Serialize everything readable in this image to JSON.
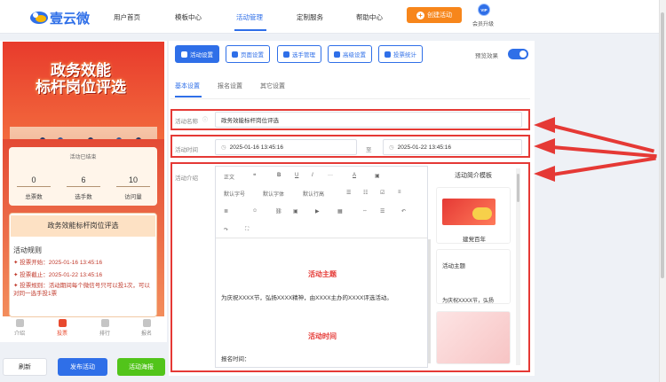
{
  "brand": {
    "name": "壹云微"
  },
  "nav": {
    "items": [
      "用户首页",
      "模板中心",
      "活动管理",
      "定制服务",
      "帮助中心"
    ],
    "active": "活动管理",
    "create_button": "创建活动",
    "vip_badge": "VIP",
    "vip_label": "会员升级"
  },
  "preview": {
    "banner_title_line1": "政务效能",
    "banner_title_line2": "标杆岗位评选",
    "status": "活动已结束",
    "stats": [
      {
        "value": "0",
        "label": "总票数"
      },
      {
        "value": "6",
        "label": "选手数"
      },
      {
        "value": "10",
        "label": "访问量"
      }
    ],
    "activity_name": "政务效能标杆岗位评选",
    "rules_title": "活动规则",
    "rules": [
      "投票开始：2025-01-16 13:45:16",
      "投票截止：2025-01-22 13:45:16",
      "投票规则：活动期间每个微信号只可以投1次，可以对同一选手投1票"
    ],
    "tabs": [
      "介绍",
      "投票",
      "排行",
      "报名"
    ],
    "active_tab": "投票"
  },
  "bottom_buttons": {
    "refresh": "刷新",
    "publish": "发布活动",
    "poster": "活动海报"
  },
  "toolbar": {
    "buttons": [
      "活动设置",
      "页面设置",
      "选手管理",
      "高级设置",
      "投票统计"
    ],
    "active": "活动设置",
    "preview_toggle_label": "预览效果",
    "preview_toggle_on": true
  },
  "subtabs": {
    "items": [
      "基本设置",
      "报名设置",
      "其它设置"
    ],
    "active": "基本设置"
  },
  "form": {
    "name_label": "活动名称",
    "name_value": "政务效能标杆岗位评选",
    "time_label": "活动时间",
    "start_time": "2025-01-16 13:45:16",
    "time_separator": "至",
    "end_time": "2025-01-22 13:45:16",
    "intro_label": "活动介绍"
  },
  "editor": {
    "toolbar_row1": [
      "正文",
      "❝",
      "B",
      "U",
      "I",
      "···",
      "A",
      "▣"
    ],
    "toolbar_row2": [
      "默认字号",
      "默认字体",
      "默认行高",
      "☰",
      "☷",
      "☑",
      "≡"
    ],
    "toolbar_row3": [
      "≣",
      "☺",
      "⛓",
      "▣",
      "▶",
      "▦",
      "⇔",
      "☰",
      "↶"
    ],
    "toolbar_row4": [
      "↷",
      "⛶"
    ],
    "heading1": "活动主题",
    "paragraph1": "为庆祝XXXX节，弘扬XXXX精神，由XXXX主办的XXXX评选活动。",
    "heading2": "活动时间",
    "paragraph2": "报名时间："
  },
  "templates": {
    "title": "活动简介模板",
    "card1_text": "建党百年",
    "card2_title": "活动主题",
    "card2_text": "为庆祝XXXX节，弘扬"
  },
  "colors": {
    "primary": "#2f6fe8",
    "accent": "#f7861b",
    "highlight": "#e53935",
    "success": "#52c41a"
  }
}
